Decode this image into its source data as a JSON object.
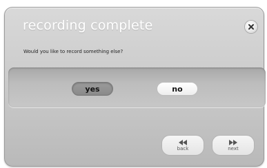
{
  "dialog": {
    "title": "recording complete",
    "prompt": "Would you like to record something else?",
    "close_icon": "close-icon"
  },
  "choices": {
    "yes_label": "yes",
    "no_label": "no"
  },
  "navigation": {
    "back_label": "back",
    "next_label": "next",
    "back_icon": "rewind-icon",
    "next_icon": "fast-forward-icon"
  }
}
